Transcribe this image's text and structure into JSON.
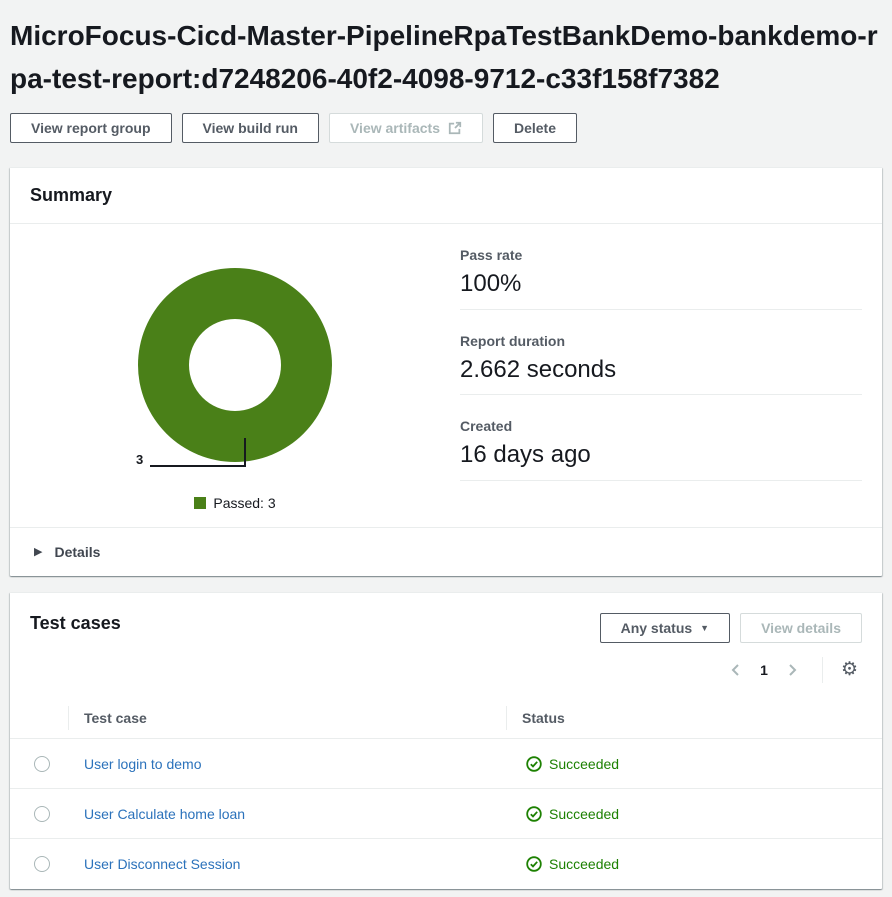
{
  "page": {
    "title": "MicroFocus-Cicd-Master-PipelineRpaTestBankDemo-bankdemo-rpa-test-report:d7248206-40f2-4098-9712-c33f158f7382"
  },
  "toolbar": {
    "view_report_group": "View report group",
    "view_build_run": "View build run",
    "view_artifacts": "View artifacts",
    "delete": "Delete"
  },
  "summary": {
    "title": "Summary",
    "details_label": "Details",
    "metrics": [
      {
        "label": "Pass rate",
        "value": "100%"
      },
      {
        "label": "Report duration",
        "value": "2.662 seconds"
      },
      {
        "label": "Created",
        "value": "16 days ago"
      }
    ]
  },
  "chart_data": {
    "type": "pie",
    "title": "Test case results donut",
    "slices": [
      {
        "label": "Passed",
        "value": 3,
        "color": "#4a8018"
      }
    ],
    "total": 3,
    "callout_label": "3",
    "legend": [
      {
        "label": "Passed: 3",
        "color": "#4a8018"
      }
    ],
    "legend_position": "bottom"
  },
  "test_cases": {
    "title": "Test cases",
    "status_filter_value": "Any status",
    "view_details_label": "View details",
    "pagination": {
      "current_page": "1"
    },
    "columns": {
      "test_case": "Test case",
      "status": "Status"
    },
    "rows": [
      {
        "name": "User login to demo",
        "status": "Succeeded"
      },
      {
        "name": "User Calculate home loan",
        "status": "Succeeded"
      },
      {
        "name": "User Disconnect Session",
        "status": "Succeeded"
      }
    ]
  },
  "icons": {
    "gear": "⚙",
    "details_triangle": "▶",
    "dropdown_caret": "▼"
  },
  "colors": {
    "page_background": "#f2f3f3",
    "link": "#2b72bb",
    "success": "#1d8102",
    "chart_passed": "#4a8018",
    "button_border": "#545b64",
    "disabled": "#aab7b8"
  }
}
